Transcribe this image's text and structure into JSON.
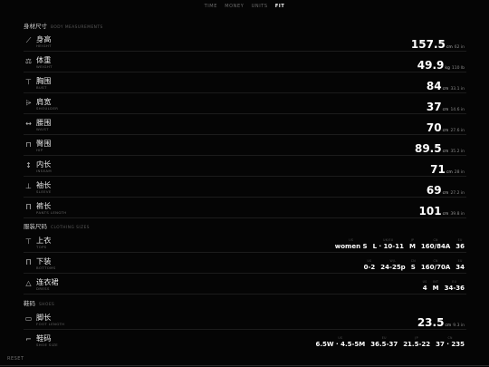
{
  "tabs": [
    {
      "label": "TIME"
    },
    {
      "label": "MONEY"
    },
    {
      "label": "UNITS"
    },
    {
      "label": "FIT"
    }
  ],
  "sections": {
    "body": {
      "title": "身材尺寸",
      "subtitle": "BODY MEASUREMENTS"
    },
    "clothing": {
      "title": "服装尺码",
      "subtitle": "CLOTHING SIZES"
    },
    "shoes": {
      "title": "鞋码",
      "subtitle": "SHOES"
    }
  },
  "body_rows": [
    {
      "zh": "身高",
      "en": "HEIGHT",
      "value": "157.5",
      "unit": "cm",
      "alt": "62 in",
      "icon": "ruler-icon"
    },
    {
      "zh": "体重",
      "en": "WEIGHT",
      "value": "49.9",
      "unit": "kg",
      "alt": "110 lb",
      "icon": "scale-icon"
    },
    {
      "zh": "胸围",
      "en": "BUST",
      "value": "84",
      "unit": "cm",
      "alt": "33.1 in",
      "icon": "shirt-icon"
    },
    {
      "zh": "肩宽",
      "en": "SHOULDER",
      "value": "37",
      "unit": "cm",
      "alt": "14.6 in",
      "icon": "shoulder-icon"
    },
    {
      "zh": "腰围",
      "en": "WAIST",
      "value": "70",
      "unit": "cm",
      "alt": "27.6 in",
      "icon": "waist-icon"
    },
    {
      "zh": "臀围",
      "en": "HIP",
      "value": "89.5",
      "unit": "cm",
      "alt": "35.2 in",
      "icon": "hip-icon"
    },
    {
      "zh": "内长",
      "en": "INSEAM",
      "value": "71",
      "unit": "cm",
      "alt": "28 in",
      "icon": "inseam-icon"
    },
    {
      "zh": "袖长",
      "en": "SLEEVE",
      "value": "69",
      "unit": "cm",
      "alt": "27.2 in",
      "icon": "sleeve-icon"
    },
    {
      "zh": "裤长",
      "en": "PANTS LENGTH",
      "value": "101",
      "unit": "cm",
      "alt": "39.8 in",
      "icon": "pants-icon"
    }
  ],
  "clothing_rows": [
    {
      "zh": "上衣",
      "en": "TOPS",
      "icon": "tops-icon",
      "sizes": [
        {
          "label": "US",
          "value": "women S"
        },
        {
          "label": "UK/EU",
          "value": "L · 10-11"
        },
        {
          "label": "JP",
          "value": "M"
        },
        {
          "label": "CN",
          "value": "160/84A"
        },
        {
          "label": "EU",
          "value": "36"
        }
      ]
    },
    {
      "zh": "下装",
      "en": "BOTTOMS",
      "icon": "bottoms-icon",
      "sizes": [
        {
          "label": "US",
          "value": "0-2"
        },
        {
          "label": "W/L",
          "value": "24-25p"
        },
        {
          "label": "CN",
          "value": "S"
        },
        {
          "label": "CN",
          "value": "160/70A"
        },
        {
          "label": "EU",
          "value": "34"
        }
      ]
    },
    {
      "zh": "连衣裙",
      "en": "DRESS",
      "icon": "dress-icon",
      "sizes": [
        {
          "label": "US",
          "value": "4"
        },
        {
          "label": "INT",
          "value": "M"
        },
        {
          "label": "EU",
          "value": "34-36"
        }
      ]
    }
  ],
  "shoe_rows": [
    {
      "zh": "脚长",
      "en": "FOOT LENGTH",
      "icon": "foot-icon",
      "value": "23.5",
      "unit": "cm",
      "alt": "9.3 in"
    },
    {
      "zh": "鞋码",
      "en": "SHOE SIZE",
      "icon": "shoe-icon",
      "sizes": [
        {
          "label": "US",
          "value": "6.5W · 4.5-5M"
        },
        {
          "label": "EU",
          "value": "36.5-37"
        },
        {
          "label": "JP",
          "value": "21.5-22"
        },
        {
          "label": "CN",
          "value": "37 · 235"
        }
      ]
    }
  ],
  "footer": {
    "reset": "RESET"
  }
}
